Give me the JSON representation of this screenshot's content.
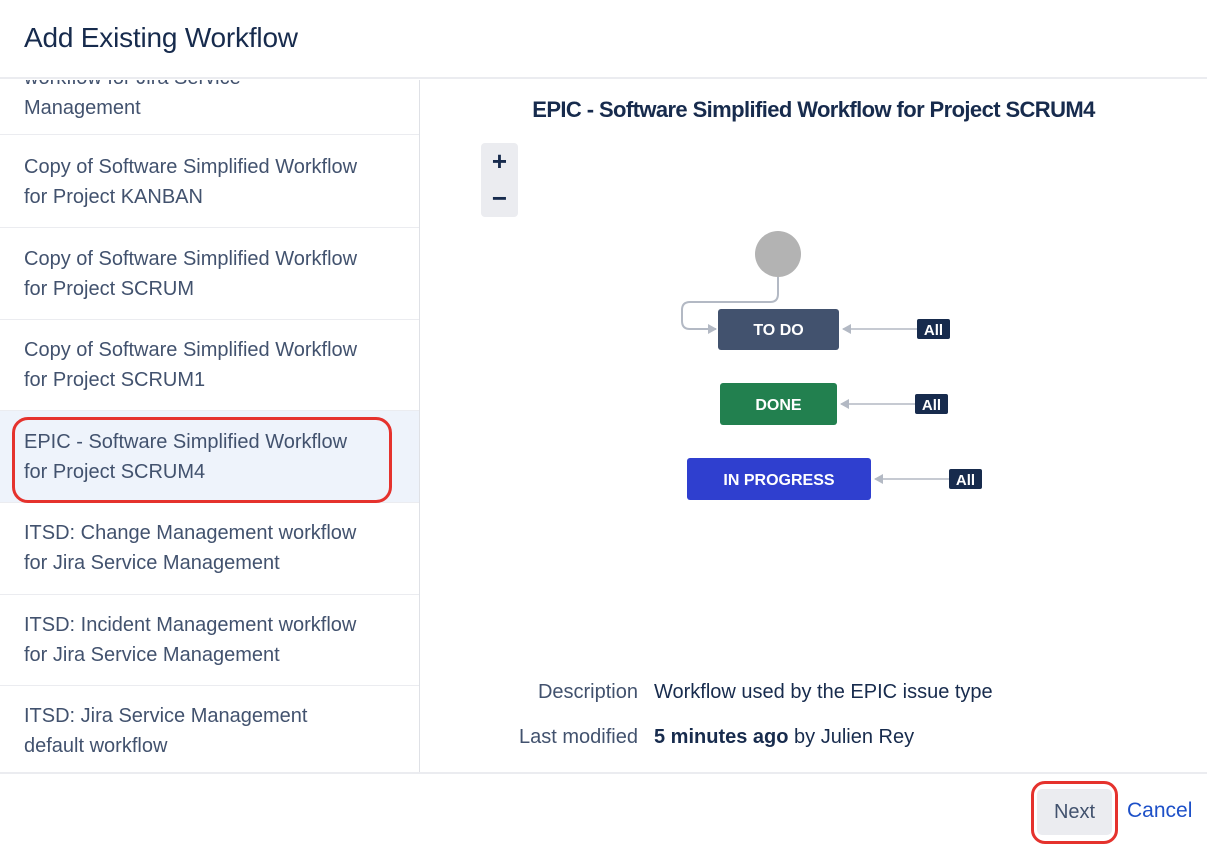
{
  "dialog": {
    "title": "Add Existing Workflow"
  },
  "sidebar": {
    "items": [
      {
        "line1": "workflow for Jira Service",
        "line2": "Management",
        "selected": false
      },
      {
        "line1": "Copy of Software Simplified Workflow",
        "line2": "for Project KANBAN",
        "selected": false
      },
      {
        "line1": "Copy of Software Simplified Workflow",
        "line2": "for Project SCRUM",
        "selected": false
      },
      {
        "line1": "Copy of Software Simplified Workflow",
        "line2": "for Project SCRUM1",
        "selected": false
      },
      {
        "line1": "EPIC - Software Simplified Workflow",
        "line2": "for Project SCRUM4",
        "selected": true
      },
      {
        "line1": "ITSD: Change Management workflow",
        "line2": "for Jira Service Management",
        "selected": false
      },
      {
        "line1": "ITSD: Incident Management workflow",
        "line2": "for Jira Service Management",
        "selected": false
      },
      {
        "line1": "ITSD: Jira Service Management",
        "line2": "default workflow",
        "selected": false
      }
    ]
  },
  "preview": {
    "title": "EPIC - Software Simplified Workflow for Project SCRUM4",
    "zoom_in": "+",
    "zoom_out": "−",
    "statuses": [
      {
        "label": "TO DO",
        "color": "#42526e"
      },
      {
        "label": "DONE",
        "color": "#22804f"
      },
      {
        "label": "IN PROGRESS",
        "color": "#2f3fcf"
      }
    ],
    "all_label": "All",
    "description_label": "Description",
    "description_value": "Workflow used by the EPIC issue type",
    "modified_label": "Last modified",
    "modified_time": "5 minutes ago",
    "modified_by": "by Julien Rey"
  },
  "footer": {
    "next_label": "Next",
    "cancel_label": "Cancel"
  }
}
